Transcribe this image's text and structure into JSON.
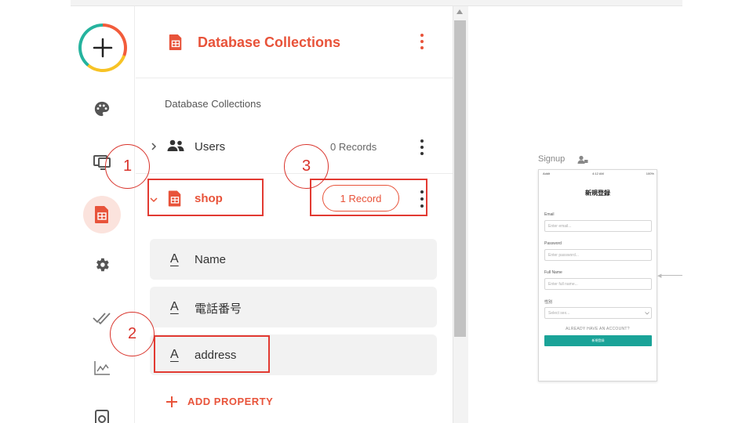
{
  "panel": {
    "title": "Database Collections",
    "section_label": "Database Collections",
    "collections": [
      {
        "name": "Users",
        "records": "0 Records"
      },
      {
        "name": "shop",
        "records": "1 Record"
      }
    ],
    "properties": [
      {
        "type_icon": "A",
        "label": "Name"
      },
      {
        "type_icon": "A",
        "label": "電話番号"
      },
      {
        "type_icon": "A",
        "label": "address"
      }
    ],
    "add_property_label": "ADD PROPERTY"
  },
  "canvas": {
    "screen_label": "Signup",
    "phone": {
      "status_left": "Addit",
      "status_center": "4:12 AM",
      "status_right": "100%",
      "title": "新規登録",
      "fields": [
        {
          "label": "Email",
          "placeholder": "Enter email..."
        },
        {
          "label": "Password",
          "placeholder": "Enter password..."
        },
        {
          "label": "Full Name",
          "placeholder": "Enter full name..."
        },
        {
          "label": "性別",
          "placeholder": "Select sex..."
        }
      ],
      "link_text": "ALREADY HAVE AN ACCOUNT?",
      "button_label": "新規登録"
    }
  },
  "annotations": [
    "1",
    "2",
    "3"
  ],
  "colors": {
    "accent": "#e8533a",
    "annotation": "#e23a32",
    "teal": "#1aa398"
  },
  "icons": [
    "add-icon",
    "palette-icon",
    "monitor-icon",
    "database-icon",
    "gear-icon",
    "check-all-icon",
    "analytics-icon",
    "publish-icon",
    "users-icon",
    "chevron-right-icon",
    "chevron-down-icon",
    "kebab-icon",
    "plus-icon",
    "user-lock-icon"
  ]
}
